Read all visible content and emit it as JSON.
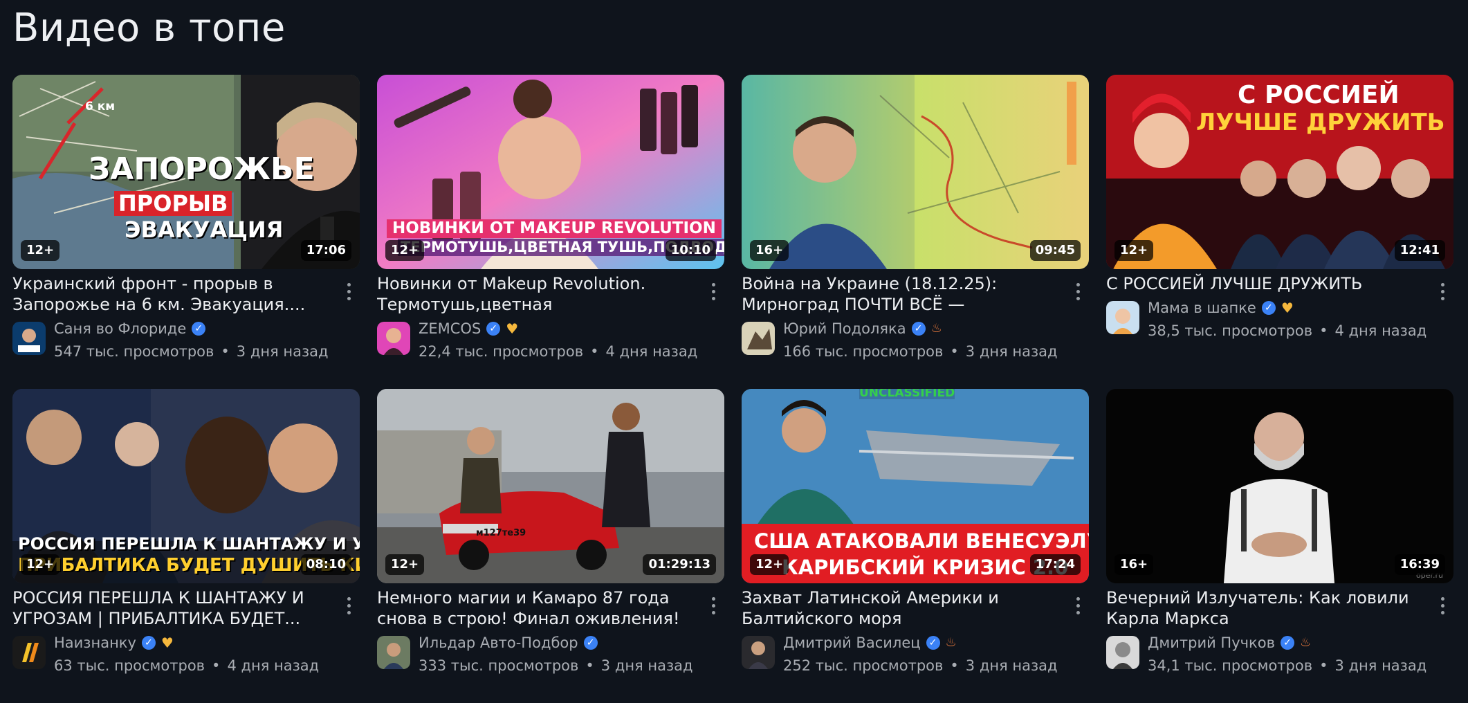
{
  "section": {
    "title": "Видео в топе"
  },
  "videos": [
    {
      "title": "Украинский фронт - прорыв в Запорожье на 6 км. Эвакуация....",
      "channel": "Саня во Флориде",
      "badges": [
        "verified"
      ],
      "views": "547 тыс. просмотров",
      "age": "3 дня назад",
      "rating": "12+",
      "duration": "17:06",
      "overlay": [
        "6 км",
        "ЗАПОРОЖЬЕ",
        "ПРОРЫВ",
        "ЭВАКУАЦИЯ"
      ]
    },
    {
      "title": "Новинки от Makeup Revolution. Термотушь,цветная тушь,подводка",
      "channel": "ZEMCOS",
      "badges": [
        "verified",
        "heart"
      ],
      "views": "22,4 тыс. просмотров",
      "age": "4 дня назад",
      "rating": "12+",
      "duration": "10:10",
      "overlay": [
        "НОВИНКИ ОТ MAKEUP REVOLUTION",
        "ТЕРМОТУШЬ,ЦВЕТНАЯ ТУШЬ,ПОДВОДКА"
      ]
    },
    {
      "title": "Война на Украине (18.12.25): Мирноград ПОЧТИ ВСЁ — осталось...",
      "channel": "Юрий Подоляка",
      "badges": [
        "verified",
        "flame"
      ],
      "views": "166 тыс. просмотров",
      "age": "3 дня назад",
      "rating": "16+",
      "duration": "09:45",
      "overlay": []
    },
    {
      "title": "С РОССИЕЙ ЛУЧШЕ ДРУЖИТЬ #МВШ",
      "channel": "Мама в шапке",
      "badges": [
        "verified",
        "heart"
      ],
      "views": "38,5 тыс. просмотров",
      "age": "4 дня назад",
      "rating": "12+",
      "duration": "12:41",
      "overlay": [
        "С РОССИЕЙ",
        "ЛУЧШЕ ДРУЖИТЬ"
      ]
    },
    {
      "title": "РОССИЯ ПЕРЕШЛА К ШАНТАЖУ И УГРОЗАМ | ПРИБАЛТИКА БУДЕТ...",
      "channel": "Наизнанку",
      "badges": [
        "verified",
        "heart"
      ],
      "views": "63 тыс. просмотров",
      "age": "4 дня назад",
      "rating": "12+",
      "duration": "08:10",
      "overlay": [
        "РОССИЯ ПЕРЕШЛА К ШАНТАЖУ И УГРОЗАМ",
        "ПРИБАЛТИКА БУДЕТ ДУШИТЬ КИТАЙ"
      ]
    },
    {
      "title": "Немного магии и Камаро 87 года снова в строю! Финал оживления!",
      "channel": "Ильдар Авто-Подбор",
      "badges": [
        "verified"
      ],
      "views": "333 тыс. просмотров",
      "age": "3 дня назад",
      "rating": "12+",
      "duration": "01:29:13",
      "overlay": [
        "м127те39"
      ]
    },
    {
      "title": "Захват Латинской Америки и Балтийского моря",
      "channel": "Дмитрий Василец",
      "badges": [
        "verified",
        "flame"
      ],
      "views": "252 тыс. просмотров",
      "age": "3 дня назад",
      "rating": "12+",
      "duration": "17:24",
      "overlay": [
        "UNCLASSIFIED",
        "США АТАКОВАЛИ ВЕНЕСУЭЛУ",
        "КАРИБСКИЙ КРИЗИС 2.0"
      ]
    },
    {
      "title": "Вечерний Излучатель: Как ловили Карла Маркса",
      "channel": "Дмитрий Пучков",
      "badges": [
        "verified",
        "flame"
      ],
      "views": "34,1 тыс. просмотров",
      "age": "3 дня назад",
      "rating": "16+",
      "duration": "16:39",
      "overlay": [
        "oper.ru"
      ]
    }
  ]
}
